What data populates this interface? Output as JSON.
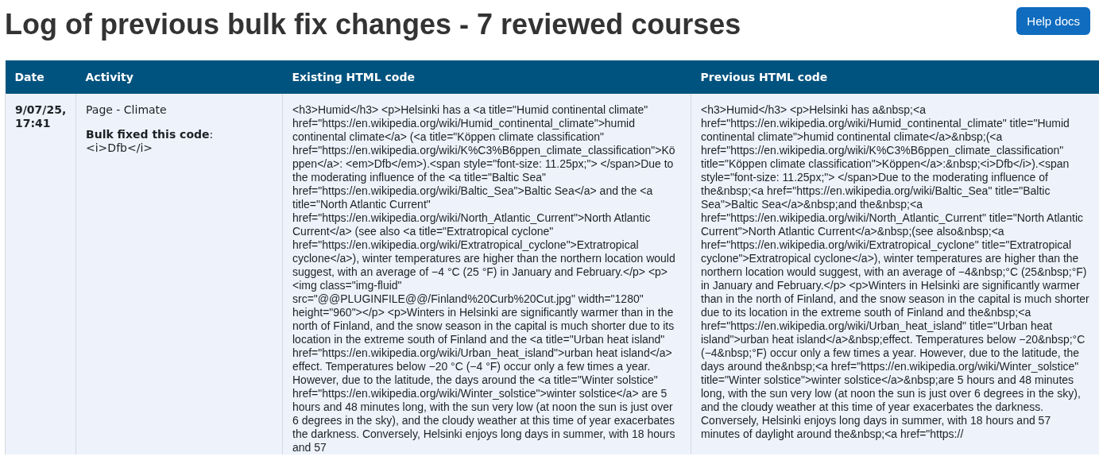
{
  "page": {
    "title": "Log of previous bulk fix changes - 7 reviewed courses",
    "help_button": "Help docs"
  },
  "table": {
    "columns": [
      "Date",
      "Activity",
      "Existing HTML code",
      "Previous HTML code"
    ],
    "rows": [
      {
        "date": "9/07/25, 17:41",
        "activity": "Page - Climate",
        "bulk_label": "**Bulk fixed this code**:",
        "bulk_code": "<i>Dfb</i>",
        "existing": "<h3>Humid</h3> <p>Helsinki has a <a title=\"Humid continental climate\" href=\"https://en.wikipedia.org/wiki/Humid_continental_climate\">humid continental climate</a> (<a title=\"Köppen climate classification\" href=\"https://en.wikipedia.org/wiki/K%C3%B6ppen_climate_classification\">Köppen</a>: <em>Dfb</em>).<span style=\"font-size: 11.25px;\"> </span>Due to the moderating influence of the <a title=\"Baltic Sea\" href=\"https://en.wikipedia.org/wiki/Baltic_Sea\">Baltic Sea</a> and the <a title=\"North Atlantic Current\" href=\"https://en.wikipedia.org/wiki/North_Atlantic_Current\">North Atlantic Current</a> (see also <a title=\"Extratropical cyclone\" href=\"https://en.wikipedia.org/wiki/Extratropical_cyclone\">Extratropical cyclone</a>), winter temperatures are higher than the northern location would suggest, with an average of −4 °C (25 °F) in January and February.</p> <p><img class=\"img-fluid\" src=\"@@PLUGINFILE@@/Finland%20Curb%20Cut.jpg\" width=\"1280\" height=\"960\"></p> <p>Winters in Helsinki are significantly warmer than in the north of Finland, and the snow season in the capital is much shorter due to its location in the extreme south of Finland and the <a title=\"Urban heat island\" href=\"https://en.wikipedia.org/wiki/Urban_heat_island\">urban heat island</a> effect. Temperatures below −20 °C (−4 °F) occur only a few times a year. However, due to the latitude, the days around the <a title=\"Winter solstice\" href=\"https://en.wikipedia.org/wiki/Winter_solstice\">winter solstice</a> are 5 hours and 48 minutes long, with the sun very low (at noon the sun is just over 6 degrees in the sky), and the cloudy weather at this time of year exacerbates the darkness. Conversely, Helsinki enjoys long days in summer, with 18 hours and 57",
        "previous": "<h3>Humid</h3> <p>Helsinki has a&nbsp;<a href=\"https://en.wikipedia.org/wiki/Humid_continental_climate\" title=\"Humid continental climate\">humid continental climate</a>&nbsp;(<a href=\"https://en.wikipedia.org/wiki/K%C3%B6ppen_climate_classification\" title=\"Köppen climate classification\">Köppen</a>:&nbsp;<i>Dfb</i>).<span style=\"font-size: 11.25px;\"> </span>Due to the moderating influence of the&nbsp;<a href=\"https://en.wikipedia.org/wiki/Baltic_Sea\" title=\"Baltic Sea\">Baltic Sea</a>&nbsp;and the&nbsp;<a href=\"https://en.wikipedia.org/wiki/North_Atlantic_Current\" title=\"North Atlantic Current\">North Atlantic Current</a>&nbsp;(see also&nbsp;<a href=\"https://en.wikipedia.org/wiki/Extratropical_cyclone\" title=\"Extratropical cyclone\">Extratropical cyclone</a>), winter temperatures are higher than the northern location would suggest, with an average of −4&nbsp;°C (25&nbsp;°F) in January and February.</p> <p>Winters in Helsinki are significantly warmer than in the north of Finland, and the snow season in the capital is much shorter due to its location in the extreme south of Finland and the&nbsp;<a href=\"https://en.wikipedia.org/wiki/Urban_heat_island\" title=\"Urban heat island\">urban heat island</a>&nbsp;effect. Temperatures below −20&nbsp;°C (−4&nbsp;°F) occur only a few times a year. However, due to the latitude, the days around the&nbsp;<a href=\"https://en.wikipedia.org/wiki/Winter_solstice\" title=\"Winter solstice\">winter solstice</a>&nbsp;are 5 hours and 48 minutes long, with the sun very low (at noon the sun is just over 6 degrees in the sky), and the cloudy weather at this time of year exacerbates the darkness. Conversely, Helsinki enjoys long days in summer, with 18 hours and 57 minutes of daylight around the&nbsp;<a href=\"https://"
      }
    ]
  }
}
